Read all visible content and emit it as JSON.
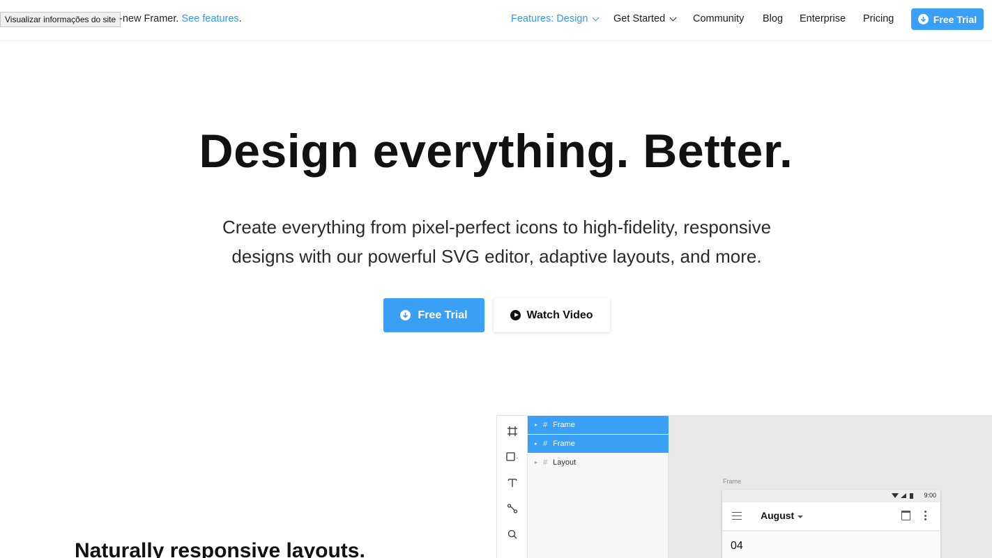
{
  "tooltip": "Visualizar informações do site",
  "announcement": {
    "text": "-new Framer.",
    "link": "See features",
    "trailing": "."
  },
  "nav": {
    "items": [
      {
        "label": "Features: Design",
        "active": true,
        "dropdown": true
      },
      {
        "label": "Get Started",
        "active": false,
        "dropdown": true
      },
      {
        "label": "Community",
        "active": false,
        "dropdown": false
      },
      {
        "label": "Blog",
        "active": false,
        "dropdown": false
      },
      {
        "label": "Enterprise",
        "active": false,
        "dropdown": false
      },
      {
        "label": "Pricing",
        "active": false,
        "dropdown": false
      }
    ],
    "cta": "Free Trial"
  },
  "hero": {
    "title": "Design everything. Better.",
    "subtitle_line1": "Create everything from pixel-perfect icons to high-fidelity, responsive",
    "subtitle_line2": "designs with our powerful SVG editor, adaptive layouts, and more.",
    "primary_button": "Free Trial",
    "secondary_button": "Watch Video"
  },
  "section": {
    "title": "Naturally responsive layouts."
  },
  "app": {
    "tools": [
      "frame-tool-icon",
      "rectangle-tool-icon",
      "text-tool-icon",
      "path-tool-icon",
      "search-icon"
    ],
    "layers": [
      {
        "name": "Frame",
        "selected": true
      },
      {
        "name": "Frame",
        "selected": true
      },
      {
        "name": "Layout",
        "selected": false
      }
    ],
    "canvas": {
      "frame_label": "Frame",
      "status_time": "9:00",
      "month": "August",
      "day": "04"
    }
  },
  "colors": {
    "accent": "#3aa0f5",
    "link": "#2f9bf4",
    "text": "#111111"
  }
}
